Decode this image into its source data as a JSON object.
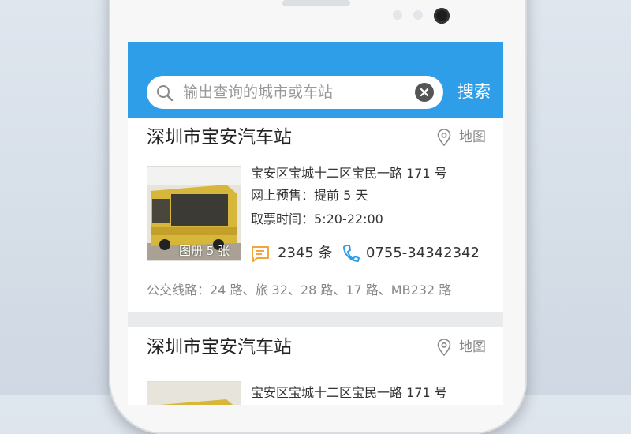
{
  "search": {
    "placeholder": "输出查询的城市或车站",
    "button_label": "搜索"
  },
  "stations": [
    {
      "name": "深圳市宝安汽车站",
      "map_label": "地图",
      "address": "宝安区宝城十二区宝民一路 171 号",
      "presale_label": "网上预售：",
      "presale_value": "提前 5 天",
      "ticket_label": "取票时间：",
      "ticket_value": "5:20-22:00",
      "photo_caption": "图册 5 张",
      "comment_count": "2345 条",
      "phone": "0755-34342342",
      "routes_label": "公交线路：",
      "routes_value": "24 路、旅 32、28 路、17 路、MB232 路"
    },
    {
      "name": "深圳市宝安汽车站",
      "map_label": "地图",
      "address": "宝安区宝城十二区宝民一路 171 号"
    }
  ],
  "colors": {
    "accent": "#2f9ee8",
    "icon_orange": "#f3a43a",
    "icon_blue": "#2f9ee8"
  },
  "icons": {
    "search": "search-icon",
    "clear": "clear-icon",
    "map": "pin-icon",
    "comment": "comment-icon",
    "phone": "phone-icon"
  }
}
